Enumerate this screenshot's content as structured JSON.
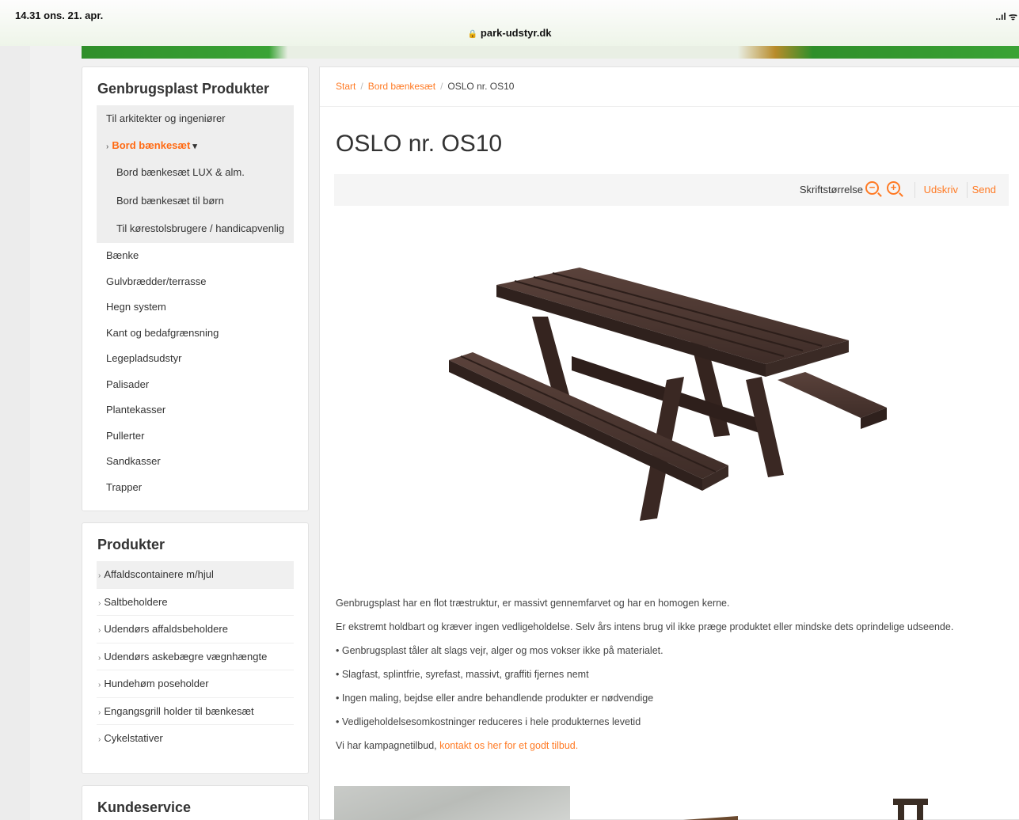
{
  "status_bar": {
    "time_date": "14.31  ons. 21. apr.",
    "signal": "..ıl ᯤ",
    "url": "park-udstyr.dk"
  },
  "sidebar_products_genbrug": {
    "title": "Genbrugsplast Produkter",
    "items": [
      {
        "label": "Til arkitekter og ingeniører"
      },
      {
        "label": "Bord bænkesæt"
      },
      {
        "label": "Bord bænkesæt LUX & alm."
      },
      {
        "label": "Bord bænkesæt til børn"
      },
      {
        "label": "Til kørestolsbrugere / handicapvenlig"
      },
      {
        "label": "Bænke"
      },
      {
        "label": "Gulvbrædder/terrasse"
      },
      {
        "label": "Hegn system"
      },
      {
        "label": "Kant og bedafgrænsning"
      },
      {
        "label": "Legepladsudstyr"
      },
      {
        "label": "Palisader"
      },
      {
        "label": "Plantekasser"
      },
      {
        "label": "Pullerter"
      },
      {
        "label": "Sandkasser"
      },
      {
        "label": "Trapper"
      }
    ]
  },
  "sidebar_products": {
    "title": "Produkter",
    "items": [
      {
        "label": "Affaldscontainere m/hjul"
      },
      {
        "label": "Saltbeholdere"
      },
      {
        "label": "Udendørs affaldsbeholdere"
      },
      {
        "label": "Udendørs askebægre vægnhængte"
      },
      {
        "label": "Hundehøm poseholder"
      },
      {
        "label": "Engangsgrill holder til bænkesæt"
      },
      {
        "label": "Cykelstativer"
      }
    ]
  },
  "sidebar_service": {
    "title": "Kundeservice"
  },
  "breadcrumb": {
    "home": "Start",
    "category": "Bord bænkesæt",
    "current": "OSLO nr. OS10",
    "separator": "/"
  },
  "page": {
    "title": "OSLO nr. OS10"
  },
  "toolbar": {
    "font_size_label": "Skriftstørrelse",
    "zoom_out": "−",
    "zoom_in": "+",
    "print": "Udskriv",
    "send": "Send"
  },
  "description": {
    "p1": "Genbrugsplast har en flot træstruktur, er massivt gennemfarvet og har en homogen kerne.",
    "p2": "Er ekstremt holdbart og kræver ingen vedligeholdelse. Selv års intens brug vil ikke præge produktet eller mindske dets oprindelige udseende.",
    "b1": "• Genbrugsplast tåler alt slags vejr, alger og mos vokser ikke på materialet.",
    "b2": "• Slagfast, splintfrie, syrefast, massivt, graffiti fjernes nemt",
    "b3": "• Ingen maling, bejdse eller andre behandlende produkter er nødvendige",
    "b4": "• Vedligeholdelsesomkostninger reduceres i hele produkternes levetid",
    "campaign_prefix": "Vi har kampagnetilbud, ",
    "campaign_link": "kontakt os her for et godt tilbud."
  },
  "colors": {
    "accent": "#ff7a24",
    "brand_green": "#3aa335",
    "product_brown": "#4a3530"
  }
}
